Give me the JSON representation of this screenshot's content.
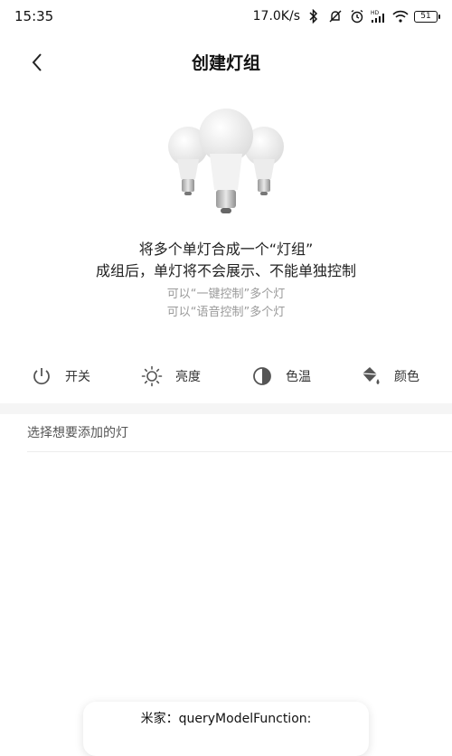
{
  "status_bar": {
    "time": "15:35",
    "net_speed": "17.0K/s",
    "battery": "51",
    "icons": [
      "bluetooth-icon",
      "mute-icon",
      "alarm-icon",
      "hd-signal-icon",
      "wifi-icon",
      "battery-icon"
    ]
  },
  "nav": {
    "back_icon": "chevron-left-icon",
    "title": "创建灯组"
  },
  "illustration": {
    "name": "light-bulbs-image"
  },
  "description": {
    "line1": "将多个单灯合成一个“灯组”",
    "line2": "成组后，单灯将不会展示、不能单独控制",
    "line3": "可以“一键控制”多个灯",
    "line4": "可以“语音控制”多个灯"
  },
  "features": [
    {
      "icon": "power-icon",
      "label": "开关"
    },
    {
      "icon": "brightness-icon",
      "label": "亮度"
    },
    {
      "icon": "color-temperature-icon",
      "label": "色温"
    },
    {
      "icon": "paint-bucket-icon",
      "label": "颜色"
    }
  ],
  "section": {
    "label": "选择想要添加的灯"
  },
  "toast": {
    "text": "米家：queryModelFunction:"
  },
  "colors": {
    "accent_gray": "#555555",
    "band": "#f5f5f5"
  }
}
